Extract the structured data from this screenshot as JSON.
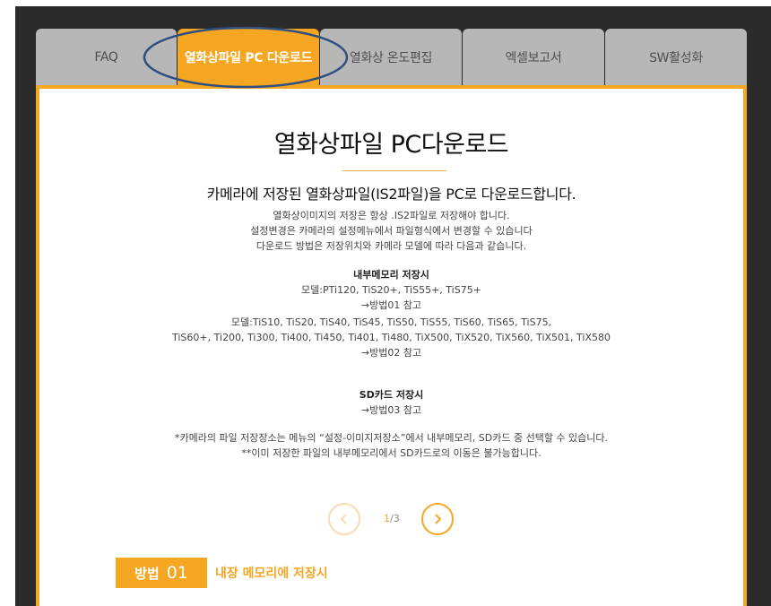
{
  "tabs": [
    {
      "label": "FAQ",
      "active": false
    },
    {
      "label": "열화상파일 PC 다운로드",
      "active": true
    },
    {
      "label": "열화상 온도편집",
      "active": false
    },
    {
      "label": "엑셀보고서",
      "active": false
    },
    {
      "label": "SW활성화",
      "active": false
    }
  ],
  "main": {
    "title": "열화상파일 PC다운로드",
    "subtitle": "카메라에 저장된 열화상파일(IS2파일)을 PC로 다운로드합니다.",
    "intro": [
      "열화상이미지의 저장은 항상 .IS2파일로 저장해야 합니다.",
      "설정변경은 카메라의 설정메뉴에서 파일형식에서 변경할 수 있습니다",
      "다운로드 방법은 저장위치와 카메라 모델에 따라 다음과 같습니다."
    ],
    "group1": {
      "heading": "내부메모리 저장시",
      "models": "모델:PTi120, TiS20+, TiS55+, TiS75+",
      "ref": "→방법01 참고"
    },
    "group2": {
      "models_line1": "모델:TiS10, TiS20, TiS40, TiS45, TiS50, TiS55, TiS60, TiS65, TiS75,",
      "models_line2": "TiS60+, Ti200, Ti300, Ti400, Ti450, Ti401, Ti480, TiX500, TiX520, TiX560, TiX501, TiX580",
      "ref": "→방법02 참고"
    },
    "group3": {
      "heading": "SD카드 저장시",
      "ref": "→방법03 참고"
    },
    "notes": [
      "*카메라의 파일 저장장소는 메뉴의 “설정-이미지저장소”에서 내부메모리, SD카드 중 선택할 수 있습니다.",
      "**이미 저장한 파일의 내부메모리에서 SD카드로의 이동은 불가능합니다."
    ],
    "pager": {
      "current": "1",
      "total": "/3"
    },
    "method": {
      "label": "방법",
      "number": "01",
      "description": "내장 메모리에 저장시"
    }
  },
  "colors": {
    "accent": "#f5a623",
    "tab_inactive": "#b7b7b7",
    "annotation": "#2f4f7f"
  },
  "icons": {
    "prev": "chevron-left-icon",
    "next": "chevron-right-icon"
  }
}
